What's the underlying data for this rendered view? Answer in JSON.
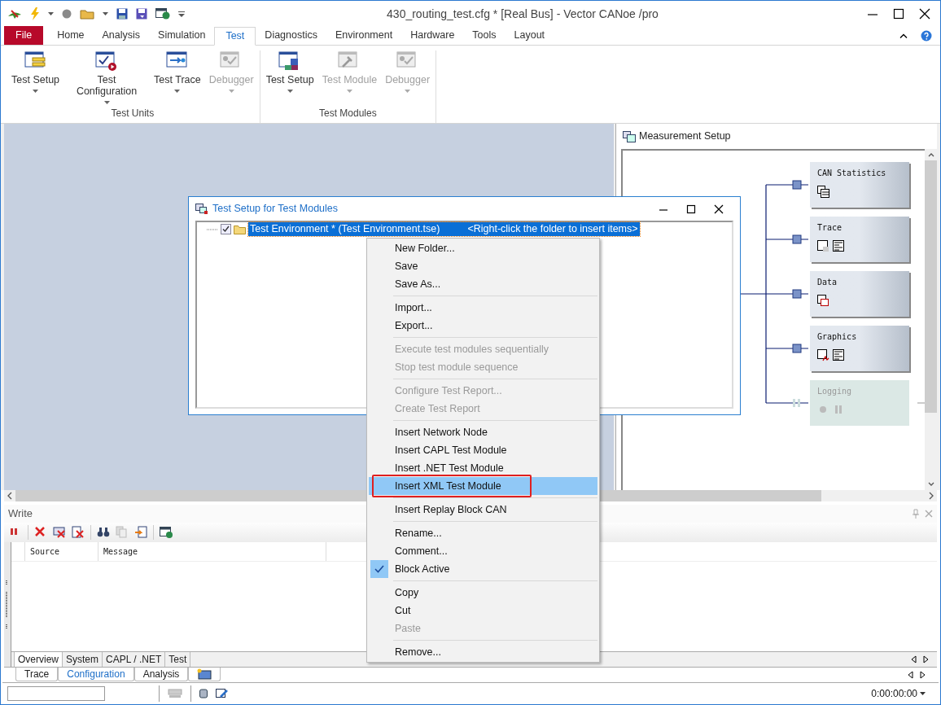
{
  "window": {
    "title": "430_routing_test.cfg * [Real Bus] - Vector CANoe /pro"
  },
  "ribbon_tabs": [
    {
      "label": "File",
      "kind": "file",
      "selected": false
    },
    {
      "label": "Home",
      "kind": "tab",
      "selected": false
    },
    {
      "label": "Analysis",
      "kind": "tab",
      "selected": false
    },
    {
      "label": "Simulation",
      "kind": "tab",
      "selected": false
    },
    {
      "label": "Test",
      "kind": "tab",
      "selected": true
    },
    {
      "label": "Diagnostics",
      "kind": "tab",
      "selected": false
    },
    {
      "label": "Environment",
      "kind": "tab",
      "selected": false
    },
    {
      "label": "Hardware",
      "kind": "tab",
      "selected": false
    },
    {
      "label": "Tools",
      "kind": "tab",
      "selected": false
    },
    {
      "label": "Layout",
      "kind": "tab",
      "selected": false
    }
  ],
  "ribbon_groups": [
    {
      "title": "Test Units",
      "buttons": [
        {
          "label": "Test Setup",
          "kind": "setup",
          "disabled": false
        },
        {
          "label": "Test Configuration",
          "kind": "configuration",
          "disabled": false
        },
        {
          "label": "Test Trace",
          "kind": "trace",
          "disabled": false
        },
        {
          "label": "Debugger",
          "kind": "debugger",
          "disabled": true
        }
      ]
    },
    {
      "title": "Test Modules",
      "buttons": [
        {
          "label": "Test Setup",
          "kind": "module-setup",
          "disabled": false
        },
        {
          "label": "Test Module",
          "kind": "module",
          "disabled": true
        },
        {
          "label": "Debugger",
          "kind": "debugger",
          "disabled": true
        }
      ]
    }
  ],
  "measurement_setup": {
    "title": "Measurement Setup",
    "blocks": [
      {
        "title": "CAN Statistics",
        "kind": "statistics",
        "active": true
      },
      {
        "title": "Trace",
        "kind": "trace",
        "active": true
      },
      {
        "title": "Data",
        "kind": "data",
        "active": true
      },
      {
        "title": "Graphics",
        "kind": "graphics",
        "active": true
      },
      {
        "title": "Logging",
        "kind": "logging",
        "active": false
      }
    ]
  },
  "dialog": {
    "title": "Test Setup for Test Modules",
    "tree": [
      {
        "label": "Test Environment *  (Test Environment.tse)",
        "hint": "<Right-click the folder to insert items>",
        "checked": true,
        "selected": true
      }
    ]
  },
  "context_menu": [
    {
      "kind": "item",
      "label": "New Folder...",
      "disabled": false,
      "checked": false,
      "selected": false
    },
    {
      "kind": "item",
      "label": "Save",
      "disabled": false,
      "checked": false,
      "selected": false
    },
    {
      "kind": "item",
      "label": "Save As...",
      "disabled": false,
      "checked": false,
      "selected": false
    },
    {
      "kind": "separator"
    },
    {
      "kind": "item",
      "label": "Import...",
      "disabled": false,
      "checked": false,
      "selected": false
    },
    {
      "kind": "item",
      "label": "Export...",
      "disabled": false,
      "checked": false,
      "selected": false
    },
    {
      "kind": "separator"
    },
    {
      "kind": "item",
      "label": "Execute test modules sequentially",
      "disabled": true,
      "checked": false,
      "selected": false
    },
    {
      "kind": "item",
      "label": "Stop test module sequence",
      "disabled": true,
      "checked": false,
      "selected": false
    },
    {
      "kind": "separator"
    },
    {
      "kind": "item",
      "label": "Configure Test Report...",
      "disabled": true,
      "checked": false,
      "selected": false
    },
    {
      "kind": "item",
      "label": "Create Test Report",
      "disabled": true,
      "checked": false,
      "selected": false
    },
    {
      "kind": "separator"
    },
    {
      "kind": "item",
      "label": "Insert Network Node",
      "disabled": false,
      "checked": false,
      "selected": false
    },
    {
      "kind": "item",
      "label": "Insert CAPL Test Module",
      "disabled": false,
      "checked": false,
      "selected": false
    },
    {
      "kind": "item",
      "label": "Insert .NET Test Module",
      "disabled": false,
      "checked": false,
      "selected": false
    },
    {
      "kind": "item",
      "label": "Insert XML Test Module",
      "disabled": false,
      "checked": false,
      "selected": true,
      "marked": true
    },
    {
      "kind": "separator"
    },
    {
      "kind": "item",
      "label": "Insert Replay Block CAN",
      "disabled": false,
      "checked": false,
      "selected": false
    },
    {
      "kind": "separator"
    },
    {
      "kind": "item",
      "label": "Rename...",
      "disabled": false,
      "checked": false,
      "selected": false
    },
    {
      "kind": "item",
      "label": "Comment...",
      "disabled": false,
      "checked": false,
      "selected": false
    },
    {
      "kind": "item",
      "label": "Block Active",
      "disabled": false,
      "checked": true,
      "selected": false
    },
    {
      "kind": "separator"
    },
    {
      "kind": "item",
      "label": "Copy",
      "disabled": false,
      "checked": false,
      "selected": false
    },
    {
      "kind": "item",
      "label": "Cut",
      "disabled": false,
      "checked": false,
      "selected": false
    },
    {
      "kind": "item",
      "label": "Paste",
      "disabled": true,
      "checked": false,
      "selected": false
    },
    {
      "kind": "separator"
    },
    {
      "kind": "item",
      "label": "Remove...",
      "disabled": false,
      "checked": false,
      "selected": false
    }
  ],
  "write_window": {
    "title": "Write",
    "columns": [
      "Source",
      "Message"
    ],
    "tabs": [
      {
        "label": "Overview",
        "selected": true
      },
      {
        "label": "System",
        "selected": false
      },
      {
        "label": "CAPL / .NET",
        "selected": false
      },
      {
        "label": "Test",
        "selected": false
      }
    ]
  },
  "desktop_tabs": [
    {
      "label": "Trace",
      "kind": "text",
      "selected": false
    },
    {
      "label": "Configuration",
      "kind": "text",
      "selected": true
    },
    {
      "label": "Analysis",
      "kind": "text",
      "selected": false
    },
    {
      "kind": "icon",
      "selected": false
    }
  ],
  "status_bar": {
    "time": "0:00:00:00"
  }
}
